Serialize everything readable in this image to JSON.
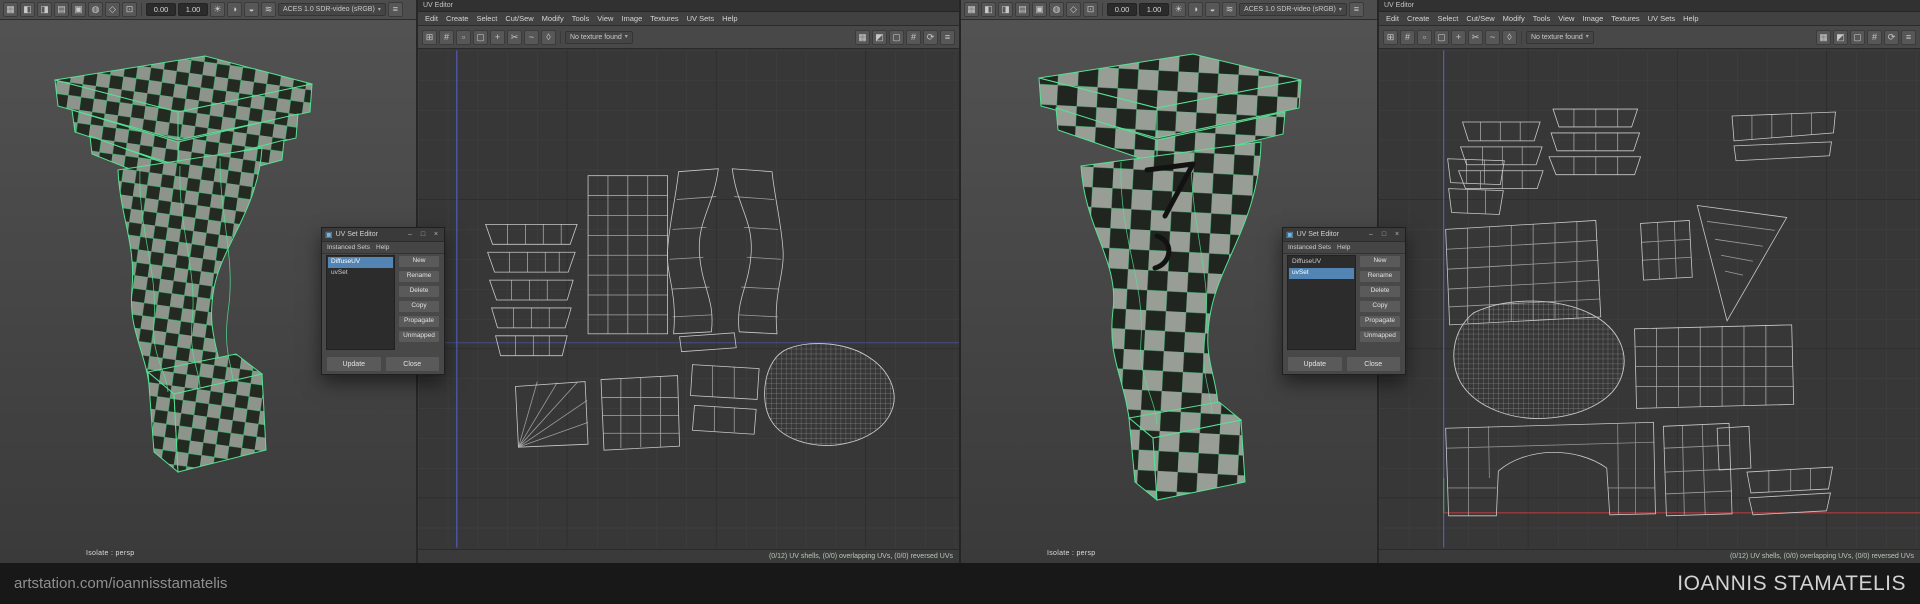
{
  "caption": {
    "left_text": "artstation.com/ioannisstamatelis",
    "right_text": "IOANNIS STAMATELIS"
  },
  "viewport_toolbar": {
    "exposure_value": "0.00",
    "gamma_value": "1.00",
    "colorspace": "ACES 1.0 SDR-video (sRGB)",
    "icons_left": [
      {
        "name": "select-camera-icon",
        "glyph": "▦"
      },
      {
        "name": "lock-camera-icon",
        "glyph": "◧"
      },
      {
        "name": "camera-settings-icon",
        "glyph": "◨"
      },
      {
        "name": "bookmarks-icon",
        "glyph": "▤"
      },
      {
        "name": "image-plane-icon",
        "glyph": "▣"
      },
      {
        "name": "two-d-pan-zoom-icon",
        "glyph": "◍"
      },
      {
        "name": "grease-pencil-icon",
        "glyph": "◇"
      },
      {
        "name": "film-gate-icon",
        "glyph": "⊡"
      }
    ],
    "icons_mid": [
      {
        "name": "lighting-icon",
        "glyph": "☀"
      },
      {
        "name": "shadows-icon",
        "glyph": "◑"
      },
      {
        "name": "ambient-occlusion-icon",
        "glyph": "◒"
      },
      {
        "name": "motion-blur-icon",
        "glyph": "≋"
      }
    ],
    "icons_right": [
      {
        "name": "renderer-menu-icon",
        "glyph": "≡"
      }
    ]
  },
  "viewport": {
    "isolate_label": "Isolate : persp"
  },
  "uv_editor": {
    "panel_title": "UV Editor",
    "menus": [
      "Edit",
      "Create",
      "Select",
      "Cut/Sew",
      "Modify",
      "Tools",
      "View",
      "Image",
      "Textures",
      "UV Sets",
      "Help"
    ],
    "no_texture_label": "No texture found",
    "status": "(0/12) UV shells, (0/0) overlapping UVs, (0/0) reversed UVs",
    "toolbar_icons_left": [
      {
        "name": "uv-grid-icon",
        "glyph": "⊞"
      },
      {
        "name": "snap-to-grid-icon",
        "glyph": "#"
      },
      {
        "name": "pixel-snap-icon",
        "glyph": "▫"
      },
      {
        "name": "shell-select-icon",
        "glyph": "▢"
      },
      {
        "name": "move-uv-icon",
        "glyph": "+"
      },
      {
        "name": "cut-uv-icon",
        "glyph": "✂"
      },
      {
        "name": "sew-uv-icon",
        "glyph": "~"
      },
      {
        "name": "unfold-uv-icon",
        "glyph": "◊"
      }
    ],
    "toolbar_icons_right": [
      {
        "name": "checker-map-icon",
        "glyph": "▦"
      },
      {
        "name": "distortion-display-icon",
        "glyph": "◩"
      },
      {
        "name": "texture-borders-icon",
        "glyph": "▢"
      },
      {
        "name": "grid-numbers-icon",
        "glyph": "#"
      },
      {
        "name": "refresh-icon",
        "glyph": "⟳"
      },
      {
        "name": "editor-options-icon",
        "glyph": "≡"
      }
    ]
  },
  "uv_set_editor": {
    "window_title": "UV Set Editor",
    "window_icon": "▣",
    "window_controls": [
      "–",
      "□",
      "×"
    ],
    "menus": [
      "Instanced Sets",
      "Help"
    ],
    "uv_sets": [
      "DiffuseUV",
      "uvSet"
    ],
    "side_buttons": [
      "New",
      "Rename",
      "Delete",
      "Copy",
      "Propagate",
      "Unmapped"
    ],
    "footer_buttons": [
      "Update",
      "Close"
    ]
  },
  "panels": [
    {
      "uvset_selected": 0
    },
    {
      "uvset_selected": 1
    }
  ],
  "colors": {
    "selection_blue": "#5285b4",
    "wireframe_green": "#55e393",
    "axis_blue": "#5560c8",
    "axis_red": "#b43a3a",
    "axis_green": "#3aa53a"
  }
}
